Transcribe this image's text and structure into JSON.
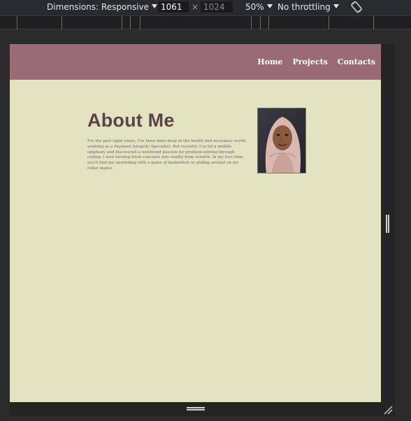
{
  "toolbar": {
    "dimensions_label": "Dimensions: Responsive",
    "width_value": "1061",
    "height_placeholder": "1024",
    "times_symbol": "×",
    "zoom_label": "50%",
    "throttle_label": "No throttling"
  },
  "site": {
    "nav": {
      "home": "Home",
      "projects": "Projects",
      "contacts": "Contacts"
    },
    "about": {
      "title": "About Me",
      "text": "For the past eight years, I've been knee-deep in the health and insurance world, working as a Payment Integrity Specialist. But recently, I've hit a midlife epiphany and discovered a newfound passion for problem-solving through coding. I love turning fresh concepts into reality from scratch. In my free time, you'll find me unwinding with a game of badminton or gliding around on my roller skates."
    }
  },
  "colors": {
    "header_bg": "#9a6b74",
    "page_bg": "#e2e3c1",
    "title_color": "#5a4448",
    "devtools_bg": "#292a2d"
  },
  "icons": {
    "rotate": "rotate-device-icon",
    "resize": "corner-resize-icon"
  }
}
